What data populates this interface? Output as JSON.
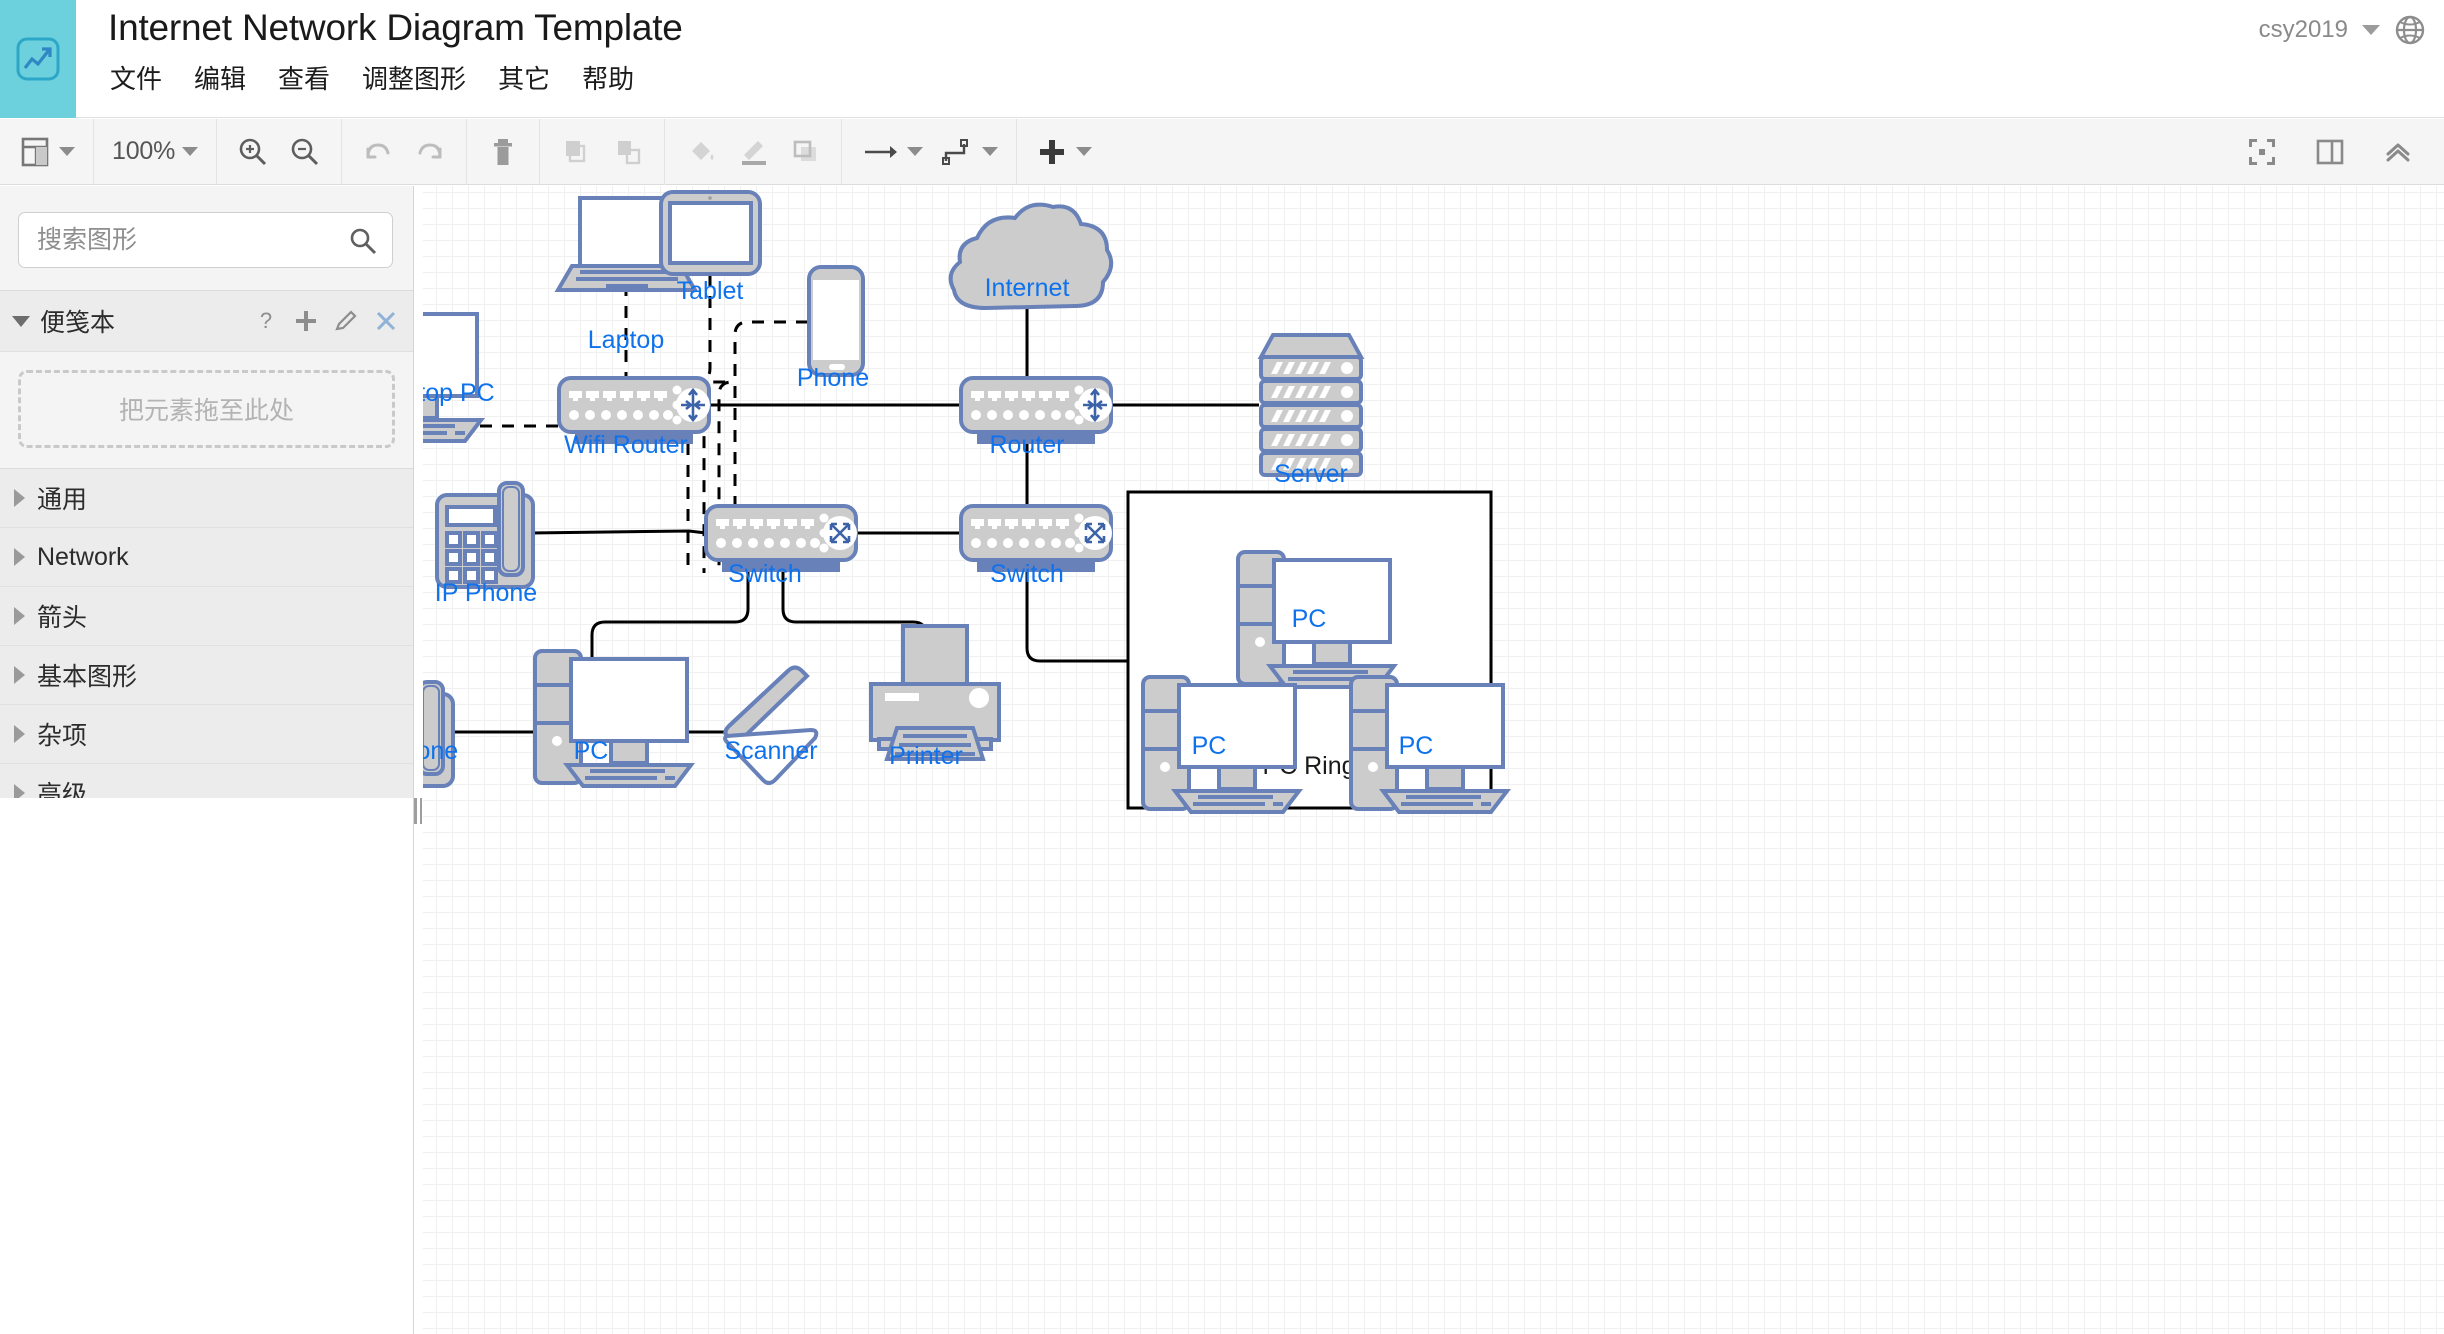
{
  "header": {
    "logo_icon": "chart-logo-icon",
    "title": "Internet Network Diagram Template",
    "menus": [
      {
        "label": "文件"
      },
      {
        "label": "编辑"
      },
      {
        "label": "查看"
      },
      {
        "label": "调整图形"
      },
      {
        "label": "其它"
      },
      {
        "label": "帮助"
      }
    ],
    "user": "csy2019",
    "globe_icon": "globe-icon"
  },
  "toolbar": {
    "layout_icon": "panel-layout-icon",
    "zoom_value": "100%",
    "zoom_in_icon": "zoom-in-icon",
    "zoom_out_icon": "zoom-out-icon",
    "undo_icon": "undo-icon",
    "redo_icon": "redo-icon",
    "delete_icon": "trash-icon",
    "to_front_icon": "bring-to-front-icon",
    "to_back_icon": "send-to-back-icon",
    "fill_icon": "fill-color-icon",
    "line_icon": "line-color-icon",
    "shadow_icon": "shadow-icon",
    "arrow_icon": "arrow-style-icon",
    "waypoint_icon": "waypoint-style-icon",
    "insert_icon": "insert-plus-icon",
    "fullscreen_icon": "fullscreen-icon",
    "format_panel_icon": "format-panel-icon",
    "collapse_icon": "collapse-chevron-icon"
  },
  "sidebar": {
    "search": {
      "placeholder": "搜索图形",
      "value": "",
      "icon": "search-icon"
    },
    "scratchpad": {
      "title": "便笺本",
      "help_icon": "help-question-icon",
      "add_icon": "plus-icon",
      "edit_icon": "pencil-icon",
      "close_icon": "close-x-icon",
      "dropzone_text": "把元素拖至此处"
    },
    "categories": [
      {
        "label": "通用"
      },
      {
        "label": "Network"
      },
      {
        "label": "箭头"
      },
      {
        "label": "基本图形"
      },
      {
        "label": "杂项"
      },
      {
        "label": "高级"
      }
    ]
  },
  "diagram": {
    "title": "Internet Network Diagram",
    "accent_label_color": "#0e72ed",
    "shape_fill": "#cccccc",
    "shape_stroke": "#6881b8",
    "nodes": [
      {
        "id": "laptop",
        "label": "Laptop",
        "type": "laptop"
      },
      {
        "id": "tablet",
        "label": "Tablet",
        "type": "tablet"
      },
      {
        "id": "phone",
        "label": "Phone",
        "type": "smartphone"
      },
      {
        "id": "desktop-pc",
        "label": "Desktop PC",
        "type": "desktop"
      },
      {
        "id": "wifi-router",
        "label": "Wifi Router",
        "type": "router"
      },
      {
        "id": "internet",
        "label": "Internet",
        "type": "cloud"
      },
      {
        "id": "router",
        "label": "Router",
        "type": "router"
      },
      {
        "id": "server",
        "label": "Server",
        "type": "server"
      },
      {
        "id": "ip-phone-1",
        "label": "IP Phone",
        "type": "ip-phone"
      },
      {
        "id": "switch-1",
        "label": "Switch",
        "type": "switch"
      },
      {
        "id": "switch-2",
        "label": "Switch",
        "type": "switch"
      },
      {
        "id": "ip-phone-2",
        "label": "IP Phone",
        "type": "ip-phone"
      },
      {
        "id": "pc-main",
        "label": "PC",
        "type": "desktop"
      },
      {
        "id": "scanner",
        "label": "Scanner",
        "type": "scanner"
      },
      {
        "id": "printer",
        "label": "Printer",
        "type": "printer"
      },
      {
        "id": "pc-ring-top",
        "label": "PC",
        "type": "desktop"
      },
      {
        "id": "pc-ring-left",
        "label": "PC",
        "type": "desktop"
      },
      {
        "id": "pc-ring-right",
        "label": "PC",
        "type": "desktop"
      }
    ],
    "groups": [
      {
        "id": "pc-ring-group",
        "label": "PC Ring"
      }
    ],
    "links": [
      {
        "from": "laptop",
        "to": "wifi-router",
        "style": "dashed"
      },
      {
        "from": "tablet",
        "to": "wifi-router",
        "style": "dashed"
      },
      {
        "from": "desktop-pc",
        "to": "wifi-router",
        "style": "dashed"
      },
      {
        "from": "phone",
        "to": "wifi-router",
        "style": "dashed"
      },
      {
        "from": "wifi-router",
        "to": "router",
        "style": "solid"
      },
      {
        "from": "internet",
        "to": "router",
        "style": "solid"
      },
      {
        "from": "router",
        "to": "server",
        "style": "solid"
      },
      {
        "from": "router",
        "to": "switch-2",
        "style": "solid"
      },
      {
        "from": "ip-phone-1",
        "to": "switch-1",
        "style": "solid"
      },
      {
        "from": "switch-1",
        "to": "switch-2",
        "style": "solid"
      },
      {
        "from": "switch-1",
        "to": "pc-main",
        "style": "solid"
      },
      {
        "from": "switch-1",
        "to": "printer",
        "style": "solid"
      },
      {
        "from": "ip-phone-2",
        "to": "pc-main",
        "style": "solid"
      },
      {
        "from": "pc-main",
        "to": "scanner",
        "style": "solid"
      },
      {
        "from": "switch-2",
        "to": "pc-ring-group",
        "style": "solid"
      },
      {
        "from": "pc-ring-top",
        "to": "pc-ring-left",
        "style": "solid"
      },
      {
        "from": "pc-ring-top",
        "to": "pc-ring-right",
        "style": "solid"
      },
      {
        "from": "pc-ring-left",
        "to": "pc-ring-right",
        "style": "solid"
      }
    ]
  }
}
